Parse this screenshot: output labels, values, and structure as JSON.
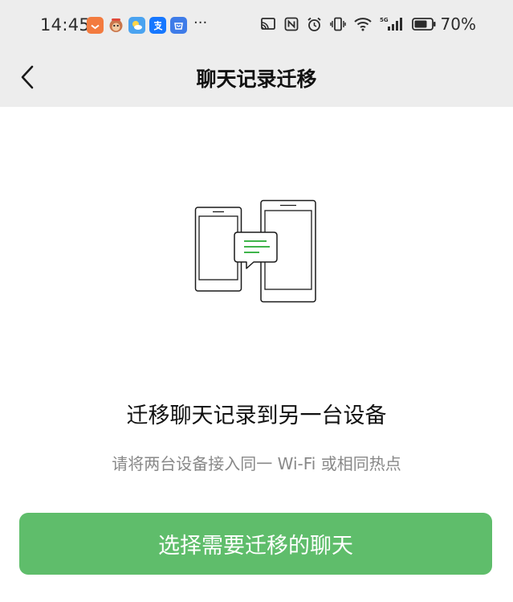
{
  "status_bar": {
    "time": "14:45",
    "more": "···",
    "battery_percent": "70%",
    "app_icons": [
      "taobao-icon",
      "monkey-app-icon",
      "weather-icon",
      "alipay-icon",
      "app-store-icon"
    ],
    "indicators": [
      "cast-icon",
      "nfc-icon",
      "alarm-icon",
      "vibrate-icon",
      "wifi-icon",
      "signal-5g-icon",
      "battery-icon"
    ],
    "signal_label": "5G"
  },
  "nav": {
    "title": "聊天记录迁移"
  },
  "content": {
    "headline": "迁移聊天记录到另一台设备",
    "subtext": "请将两台设备接入同一 Wi-Fi 或相同热点"
  },
  "action": {
    "button_label": "选择需要迁移的聊天"
  },
  "colors": {
    "header_bg": "#ededed",
    "accent_green": "#5fbd6b",
    "icon_green": "#3fb44a"
  }
}
